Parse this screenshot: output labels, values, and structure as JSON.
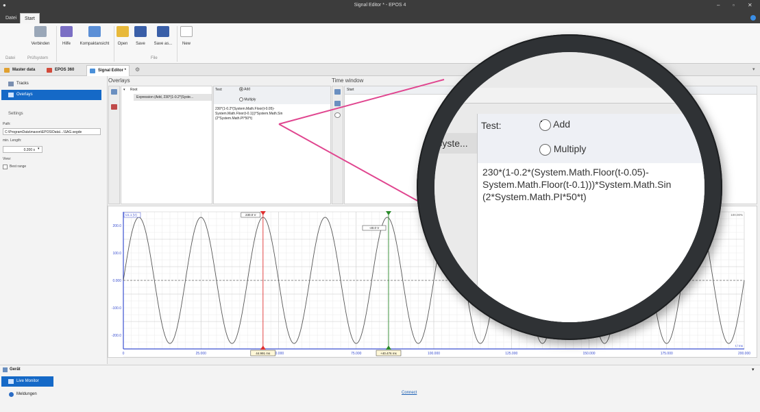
{
  "window": {
    "title": "Signal Editor * - EPOS 4"
  },
  "menu_tabs": [
    "Datei",
    "Start"
  ],
  "ribbon": {
    "buttons": {
      "connect": "Verbinden",
      "help": "Hilfe",
      "compact": "Kompaktansicht",
      "open": "Open",
      "save": "Save",
      "save_as": "Save as...",
      "new": "New"
    },
    "groups": {
      "datei": "Datei",
      "pruefsystem": "Prüfsystem",
      "file": "File"
    }
  },
  "doc_tabs": [
    "Master data",
    "EPOS 360",
    "Signal Editor *"
  ],
  "sidebar": {
    "items": [
      "Tracks",
      "Overlays"
    ],
    "settings_title": "Settings",
    "path_label": "Path:",
    "path_value": "C:\\ProgramData\\maxon\\EPOS\\Data\\...\\SAG.segde",
    "min_length_label": "min. Length:",
    "min_length_value": "0.200 s",
    "view_label": "View:",
    "best_range": "Best range"
  },
  "overlays": {
    "title": "Overlays",
    "root": "Root",
    "expression_item": "Expression (Add, 230*(1-0.2*(Syste...",
    "test_label": "Test:",
    "add": "Add",
    "multiply": "Multiply",
    "formula_lines": [
      "230*(1-0.2*(System.Math.Floor(t-0.05)-",
      "System.Math.Floor(t-0.1)))*System.Math.Sin",
      "(2*System.Math.PI*50*t)"
    ]
  },
  "time_window": {
    "title": "Time window",
    "start": "Start"
  },
  "chart_data": {
    "type": "line",
    "title": "",
    "channel_label": "U1.1 (V)",
    "top_right_label": "100.00%",
    "unit_label": "t / ms",
    "xlim": [
      0,
      200
    ],
    "ylim": [
      -250,
      250
    ],
    "x_ticks": [
      "0",
      "25.000",
      "50.000",
      "75.000",
      "100.000",
      "125.000",
      "150.000",
      "175.000",
      "200.000"
    ],
    "y_ticks": [
      "200.0",
      "100.0",
      "0.000",
      "-100.0",
      "-200.0"
    ],
    "series": [
      {
        "amplitude": 230,
        "frequency_hz": 50,
        "phase": "sin"
      }
    ],
    "cursors": [
      {
        "x": 44.991,
        "label": "44.991 ms",
        "value_label": "230.0 V",
        "color": "#e03030"
      },
      {
        "x": 85.43,
        "label": "+40.476 ms",
        "value_label": "-40.0 V",
        "color": "#2a8a2a"
      }
    ]
  },
  "bottom": {
    "section": "Gerät",
    "live_monitor": "Live Monitor",
    "messages": "Meldungen",
    "connect_link": "Connect"
  },
  "magnifier": {
    "tree_item": "Syste...",
    "test_label": "Test:",
    "add": "Add",
    "multiply": "Multiply",
    "formula_lines": [
      "230*(1-0.2*(System.Math.Floor(t-0.05)-",
      "System.Math.Floor(t-0.1)))*System.Math.Sin",
      "(2*System.Math.PI*50*t)"
    ]
  },
  "colors": {
    "accent": "#1569c7",
    "pointer": "#e0458f",
    "lens_ring": "#2f3235"
  }
}
